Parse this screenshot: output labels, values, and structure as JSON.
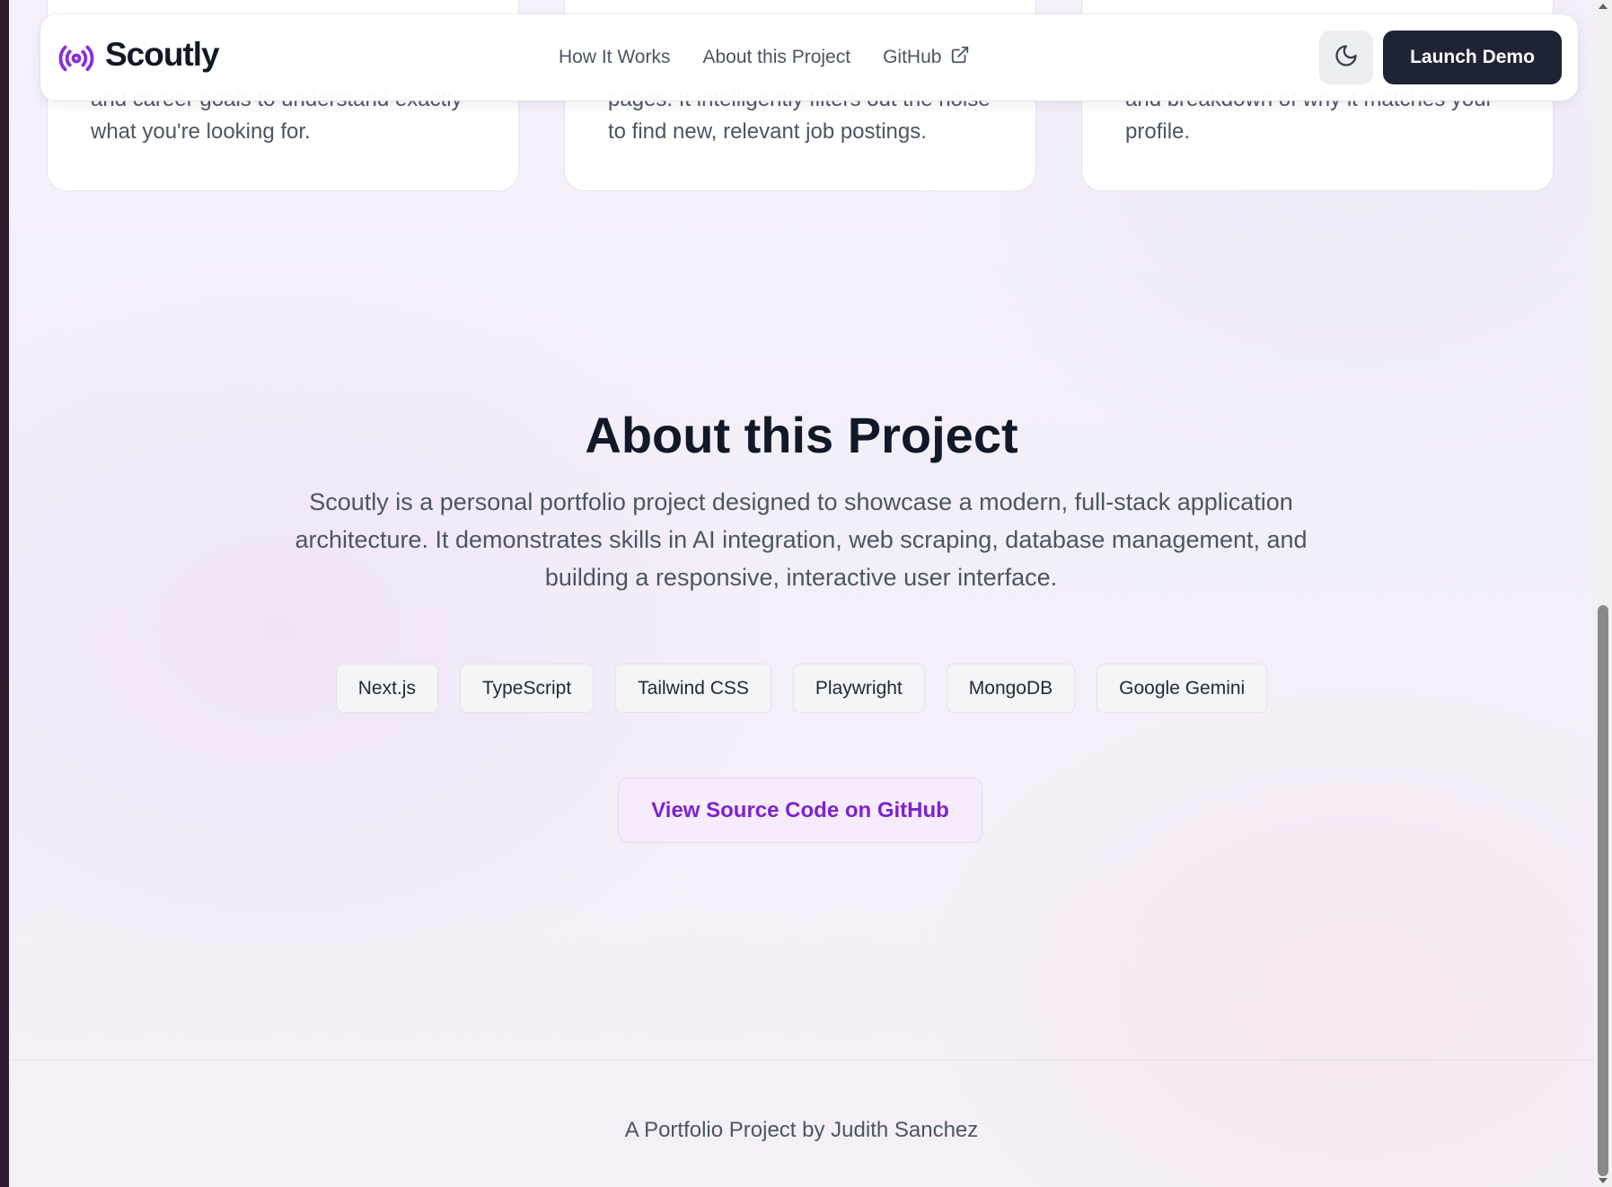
{
  "colors": {
    "accent": "#7e22ce",
    "logo_icon": "#8b2fd6",
    "heading": "#111827",
    "body_text": "#4b5563",
    "primary_button_bg": "#1e2433"
  },
  "navbar": {
    "logo_icon": "broadcast-icon",
    "brand": "Scoutly",
    "links": [
      {
        "label": "How It Works"
      },
      {
        "label": "About this Project"
      },
      {
        "label": "GitHub",
        "icon": "external-link-icon"
      }
    ],
    "theme_toggle_icon": "moon-icon",
    "launch_label": "Launch Demo"
  },
  "feature_cards": [
    {
      "text": "and career goals to understand exactly what you're looking for."
    },
    {
      "text": "pages. It intelligently filters out the noise to find new, relevant job postings."
    },
    {
      "text": "and breakdown of why it matches your profile."
    }
  ],
  "about": {
    "title": "About this Project",
    "description": "Scoutly is a personal portfolio project designed to showcase a modern, full-stack application architecture. It demonstrates skills in AI integration, web scraping, database management, and building a responsive, interactive user interface.",
    "tech_tags": [
      "Next.js",
      "TypeScript",
      "Tailwind CSS",
      "Playwright",
      "MongoDB",
      "Google Gemini"
    ],
    "source_button": "View Source Code on GitHub"
  },
  "footer": {
    "text": "A Portfolio Project by Judith Sanchez"
  }
}
